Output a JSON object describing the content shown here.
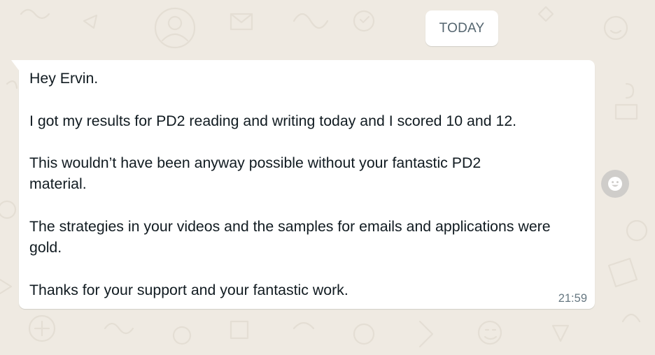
{
  "chat": {
    "date_divider": "TODAY",
    "message": {
      "paragraphs": [
        "Hey Ervin.",
        "I got my results for PD2 reading and writing today and I scored 10 and 12.",
        "This wouldn’t have been anyway possible without your fantastic PD2 material.",
        "The strategies in your videos and the samples for emails and applications were gold.",
        "Thanks for your support and your fantastic work."
      ],
      "time": "21:59"
    },
    "reaction_icon": "smiley-face-icon"
  },
  "colors": {
    "background": "#efeae2",
    "bubble": "#ffffff",
    "text": "#111b21",
    "meta_text": "#667781",
    "chip_text": "#54656f"
  }
}
